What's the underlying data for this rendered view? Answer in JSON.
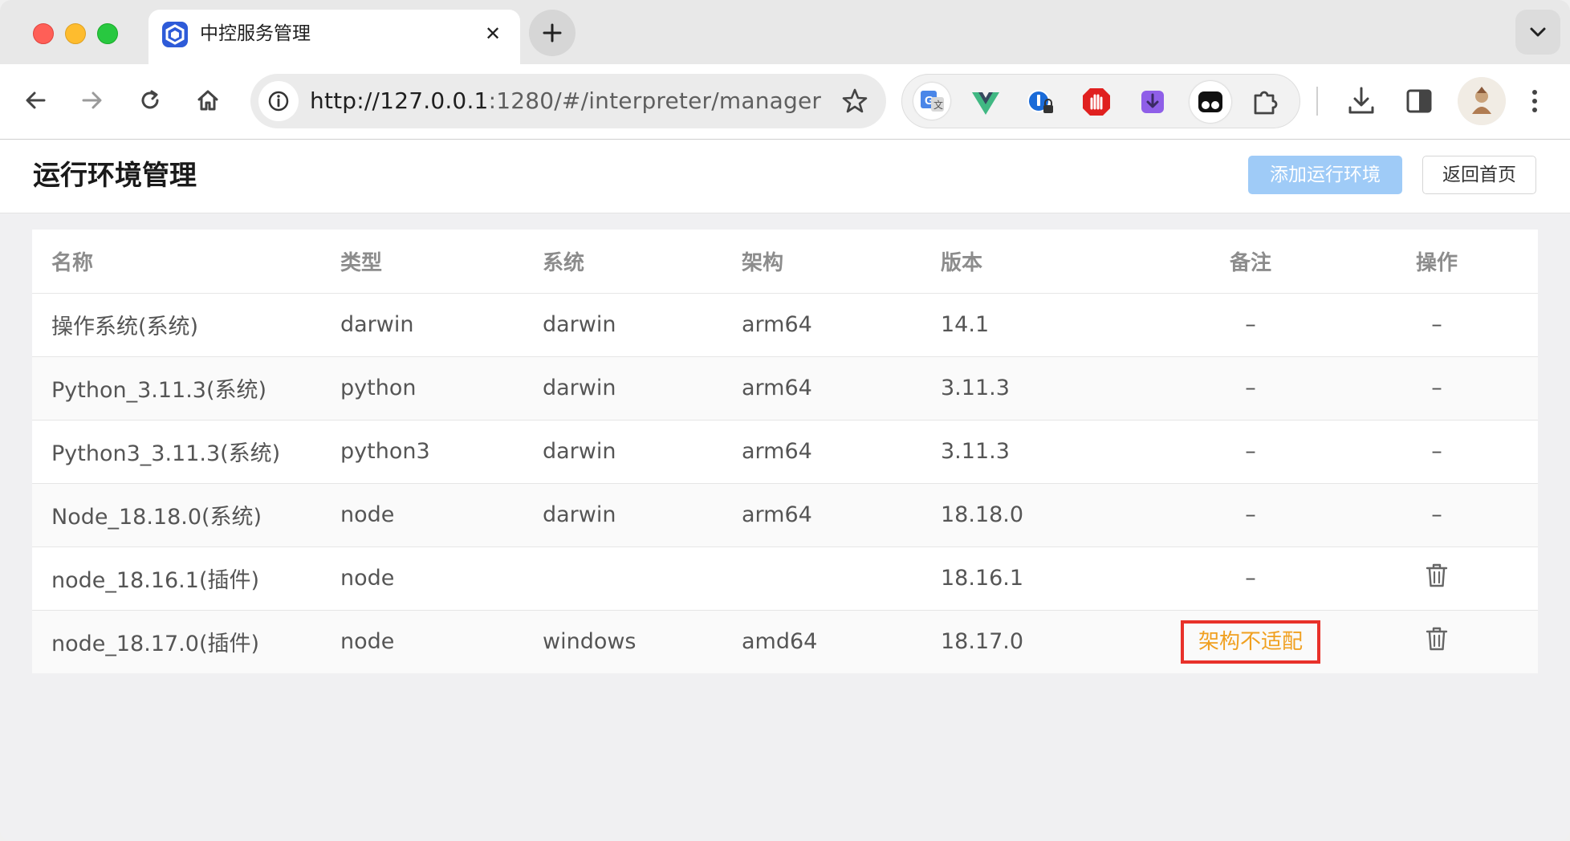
{
  "browser": {
    "tab": {
      "title": "中控服务管理"
    },
    "url": "http://127.0.0.1:1280/#/interpreter/manager",
    "url_host": "http://127.0.0.1",
    "url_rest": ":1280/#/interpreter/manager",
    "extensions": [
      "google-translate-icon",
      "vue-devtools-icon",
      "password-manager-icon",
      "adblock-icon",
      "downloader-icon",
      "tampermonkey-icon",
      "extensions-puzzle-icon"
    ]
  },
  "page": {
    "title": "运行环境管理",
    "add_button": "添加运行环境",
    "back_button": "返回首页"
  },
  "table": {
    "headers": {
      "name": "名称",
      "type": "类型",
      "system": "系统",
      "arch": "架构",
      "version": "版本",
      "note": "备注",
      "action": "操作"
    },
    "rows": [
      {
        "name": "操作系统(系统)",
        "type": "darwin",
        "system": "darwin",
        "arch": "arm64",
        "version": "14.1",
        "note": "–",
        "action": "–"
      },
      {
        "name": "Python_3.11.3(系统)",
        "type": "python",
        "system": "darwin",
        "arch": "arm64",
        "version": "3.11.3",
        "note": "–",
        "action": "–"
      },
      {
        "name": "Python3_3.11.3(系统)",
        "type": "python3",
        "system": "darwin",
        "arch": "arm64",
        "version": "3.11.3",
        "note": "–",
        "action": "–"
      },
      {
        "name": "Node_18.18.0(系统)",
        "type": "node",
        "system": "darwin",
        "arch": "arm64",
        "version": "18.18.0",
        "note": "–",
        "action": "–"
      },
      {
        "name": "node_18.16.1(插件)",
        "type": "node",
        "system": "",
        "arch": "",
        "version": "18.16.1",
        "note": "–",
        "action": "delete"
      },
      {
        "name": "node_18.17.0(插件)",
        "type": "node",
        "system": "windows",
        "arch": "amd64",
        "version": "18.17.0",
        "note": "架构不适配",
        "action": "delete"
      }
    ]
  },
  "colors": {
    "primary_button": "#9fcbf7",
    "warning_text": "#f0a020",
    "highlight_border": "#e8312a"
  }
}
